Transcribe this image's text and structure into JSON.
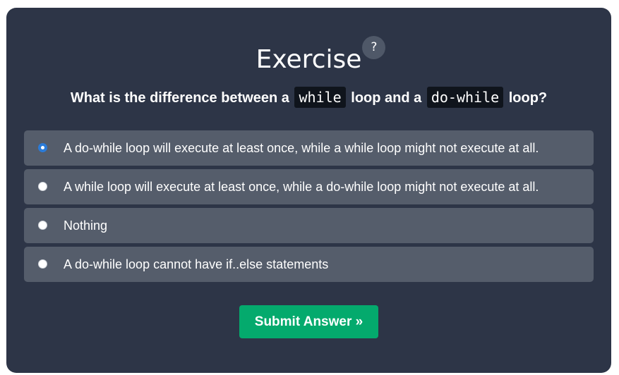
{
  "exercise": {
    "title": "Exercise",
    "help_label": "?",
    "question": {
      "part1": "What is the difference between a",
      "code1": "while",
      "part2": "loop and a",
      "code2": "do-while",
      "part3": "loop?"
    },
    "options": [
      {
        "label": "A do-while loop will execute at least once, while a while loop might not execute at all.",
        "selected": true
      },
      {
        "label": "A while loop will execute at least once, while a do-while loop might not execute at all.",
        "selected": false
      },
      {
        "label": "Nothing",
        "selected": false
      },
      {
        "label": "A do-while loop cannot have if..else statements",
        "selected": false
      }
    ],
    "submit_label": "Submit Answer »"
  },
  "colors": {
    "card_background": "#2d3547",
    "option_background": "#555d6b",
    "submit_background": "#04aa6d",
    "radio_selected": "#2b7bd8",
    "code_background": "#0f141c"
  },
  "icons": {
    "help": "question-mark-icon"
  }
}
